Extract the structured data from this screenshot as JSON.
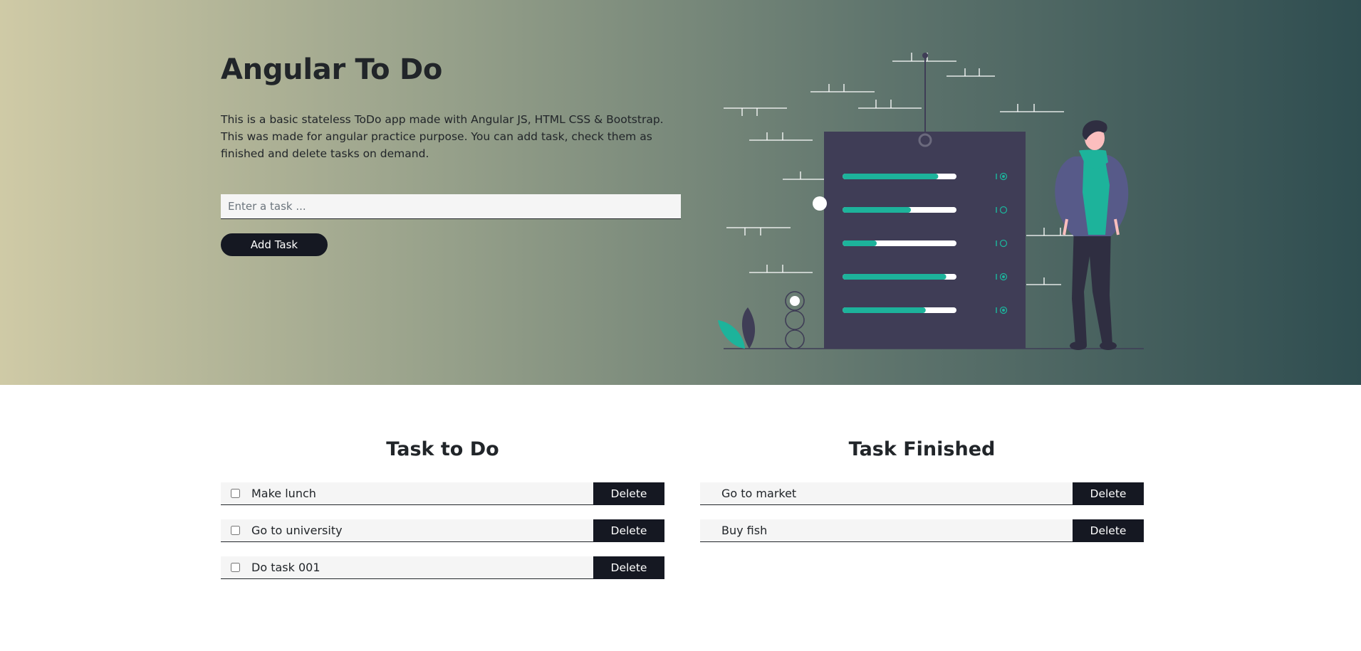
{
  "header": {
    "title": "Angular To Do",
    "description": "This is a basic stateless ToDo app made with Angular JS, HTML CSS & Bootstrap. This was made for angular practice purpose. You can add task, check them as finished and delete tasks on demand.",
    "input_placeholder": "Enter a task ...",
    "add_button_label": "Add Task"
  },
  "todo": {
    "title": "Task to Do",
    "items": [
      {
        "label": "Make lunch",
        "checked": false,
        "delete_label": "Delete"
      },
      {
        "label": "Go to university",
        "checked": false,
        "delete_label": "Delete"
      },
      {
        "label": "Do task 001",
        "checked": false,
        "delete_label": "Delete"
      }
    ]
  },
  "finished": {
    "title": "Task Finished",
    "items": [
      {
        "label": "Go to market",
        "delete_label": "Delete"
      },
      {
        "label": "Buy fish",
        "delete_label": "Delete"
      }
    ]
  },
  "illustration": {
    "progress_levels": [
      0.84,
      0.6,
      0.3,
      0.91,
      0.73
    ],
    "accent_color": "#1db39b",
    "panel_color": "#3f3d56",
    "hoodie_color": "#575a89"
  }
}
